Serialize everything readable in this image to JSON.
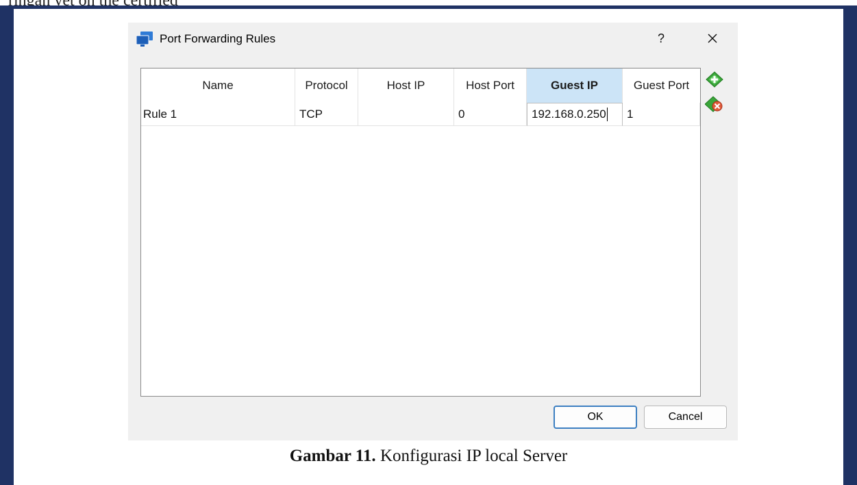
{
  "page": {
    "top_text": "ringan yet on the certified",
    "caption_label": "Gambar 11.",
    "caption_text": " Konfigurasi IP local Server"
  },
  "dialog": {
    "title": "Port Forwarding Rules",
    "help_label": "?",
    "icons": {
      "app": "virtualbox-network-icon",
      "close": "close-icon",
      "add_rule": "add-rule-icon",
      "remove_rule": "remove-rule-icon"
    },
    "table": {
      "headers": [
        "Name",
        "Protocol",
        "Host IP",
        "Host Port",
        "Guest IP",
        "Guest Port"
      ],
      "active_header": "Guest IP",
      "rows": [
        {
          "name": "Rule 1",
          "protocol": "TCP",
          "host_ip": "",
          "host_port": "0",
          "guest_ip": "192.168.0.250",
          "guest_port": "1"
        }
      ]
    },
    "buttons": {
      "ok": "OK",
      "cancel": "Cancel"
    }
  },
  "colors": {
    "frame": "#1f3264",
    "active_header": "#cce4f7",
    "default_button_border": "#3c7fc1",
    "add_icon": "#3aa53a",
    "remove_icon": "#e05a3a"
  }
}
